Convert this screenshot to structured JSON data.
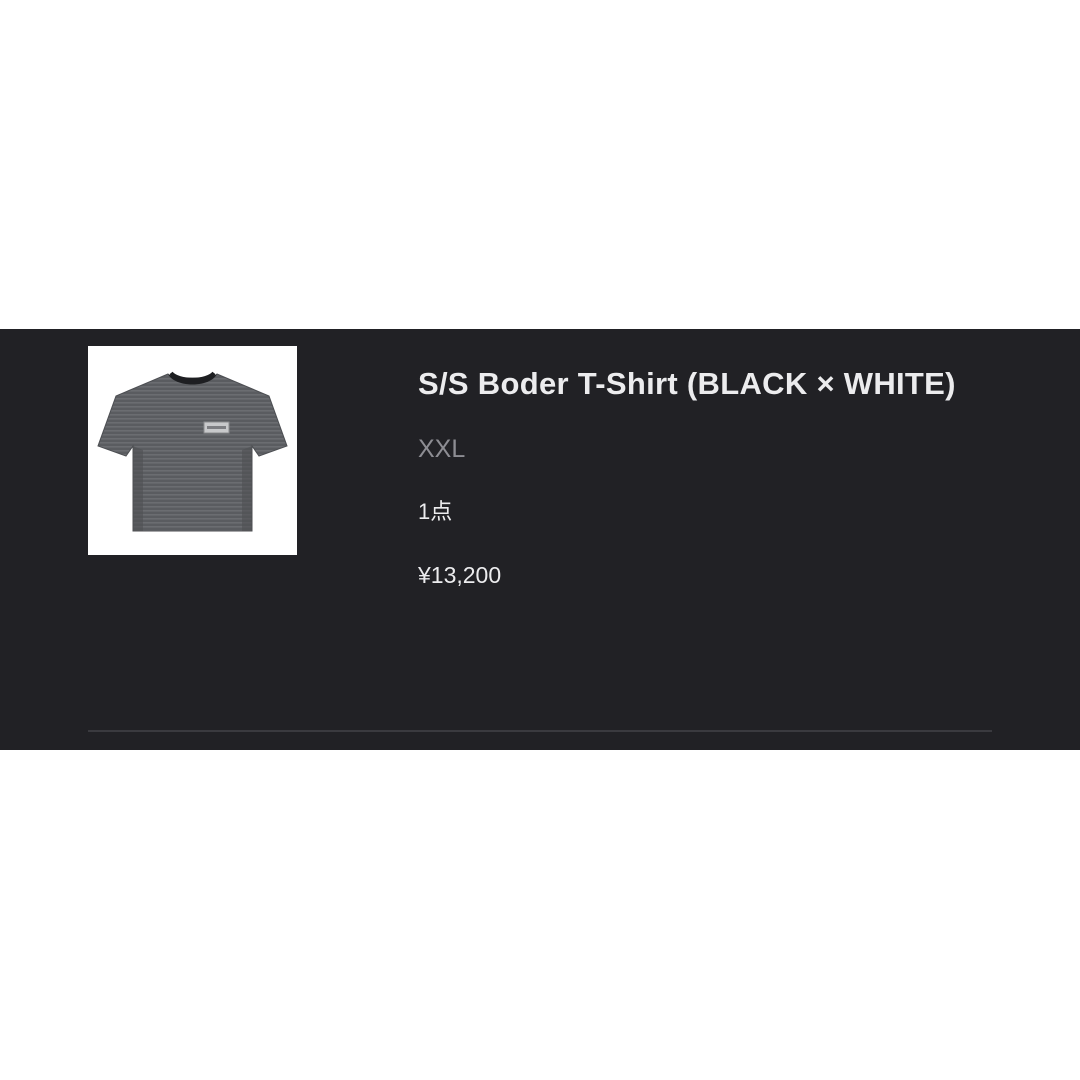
{
  "order_item": {
    "image_alt": "S/S Boder T-Shirt product image",
    "title": "S/S Boder T-Shirt (BLACK × WHITE)",
    "size": "XXL",
    "quantity": "1点",
    "price": "¥13,200"
  },
  "colors": {
    "band_background": "#212125",
    "page_background": "#ffffff",
    "title_text": "#ececee",
    "muted_text": "#8d8d93",
    "divider": "#3a3a3f"
  },
  "icons": {
    "product_image": "t-shirt-photo"
  }
}
